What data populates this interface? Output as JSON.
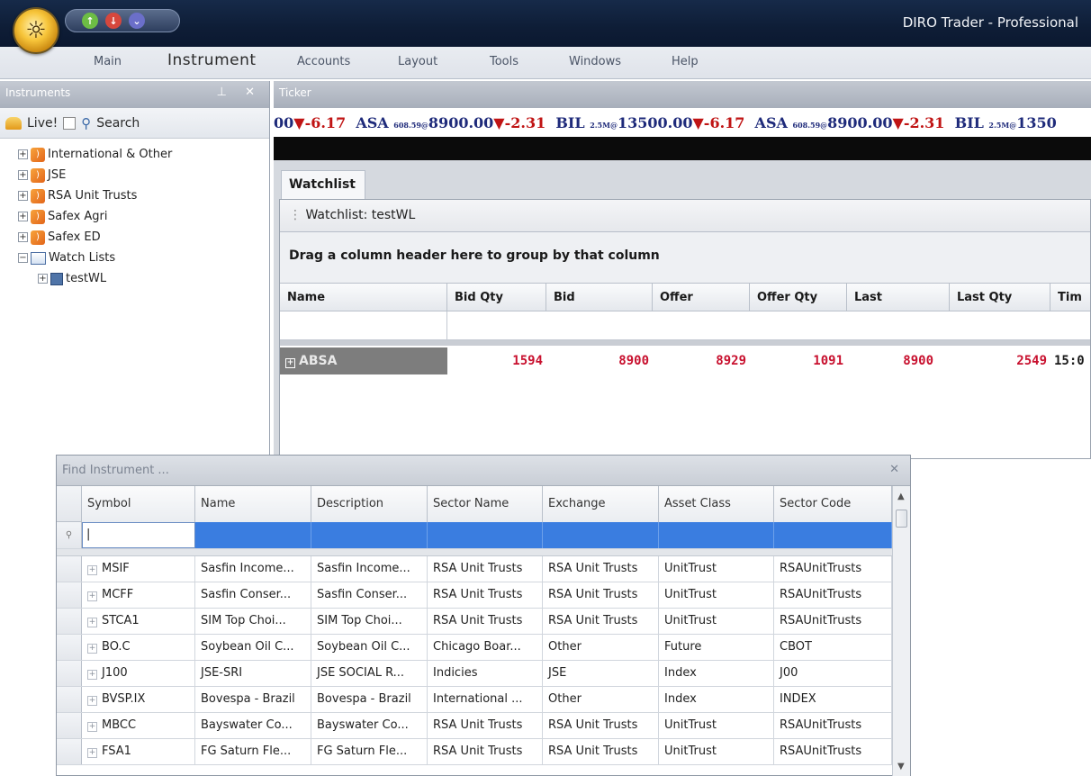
{
  "app": {
    "title": "DIRO Trader - Professional",
    "orb_icon": "logo-orb-icon"
  },
  "menu": [
    "Main",
    "Instrument",
    "Accounts",
    "Layout",
    "Tools",
    "Windows",
    "Help"
  ],
  "instruments_panel": {
    "title": "Instruments",
    "header_icons": "⊥ ✕",
    "toolbar": {
      "live_label": "Live!",
      "search_label": "Search"
    },
    "tree": [
      {
        "label": "International & Other",
        "icon": "rss-icon",
        "level": 0
      },
      {
        "label": "JSE",
        "icon": "rss-icon",
        "level": 0
      },
      {
        "label": "RSA Unit Trusts",
        "icon": "rss-icon",
        "level": 0
      },
      {
        "label": "Safex Agri",
        "icon": "rss-icon",
        "level": 0
      },
      {
        "label": "Safex ED",
        "icon": "rss-icon",
        "level": 0
      },
      {
        "label": "Watch Lists",
        "icon": "book-icon",
        "level": 0
      },
      {
        "label": "testWL",
        "icon": "watchlist-icon",
        "level": 1
      }
    ]
  },
  "ticker": {
    "title": "Ticker",
    "items": [
      {
        "text": "00",
        "change": "-6.17"
      },
      {
        "text": "ASA",
        "sub": "608.59@",
        "price": "8900.00",
        "change": "-2.31"
      },
      {
        "text": "BIL",
        "sub": "2.5M@",
        "price": "13500.00",
        "change": "-6.17"
      },
      {
        "text": "ASA",
        "sub": "608.59@",
        "price": "8900.00",
        "change": "-2.31"
      },
      {
        "text": "BIL",
        "sub": "2.5M@",
        "price": "1350"
      }
    ]
  },
  "watchlist": {
    "tab_label": "Watchlist",
    "subtitle": "Watchlist: testWL",
    "group_hint": "Drag a column header here to group by that column",
    "columns": [
      "Name",
      "Bid Qty",
      "Bid",
      "Offer",
      "Offer Qty",
      "Last",
      "Last Qty",
      "Tim"
    ],
    "rows": [
      {
        "name": "ABSA",
        "bid_qty": "1594",
        "bid": "8900",
        "offer": "8929",
        "offer_qty": "1091",
        "last": "8900",
        "last_qty": "2549",
        "time": "15:0"
      }
    ]
  },
  "find_instrument": {
    "title": "Find Instrument ...",
    "close": "✕",
    "columns": [
      "Symbol",
      "Name",
      "Description",
      "Sector Name",
      "Exchange",
      "Asset Class",
      "Sector Code"
    ],
    "filter_value": "|",
    "rows": [
      [
        "MSIF",
        "Sasfin Income...",
        "Sasfin Income...",
        "RSA Unit Trusts",
        "RSA Unit Trusts",
        "UnitTrust",
        "RSAUnitTrusts"
      ],
      [
        "MCFF",
        "Sasfin Conser...",
        "Sasfin Conser...",
        "RSA Unit Trusts",
        "RSA Unit Trusts",
        "UnitTrust",
        "RSAUnitTrusts"
      ],
      [
        "STCA1",
        "SIM Top Choi...",
        "SIM Top Choi...",
        "RSA Unit Trusts",
        "RSA Unit Trusts",
        "UnitTrust",
        "RSAUnitTrusts"
      ],
      [
        "BO.C",
        "Soybean Oil C...",
        "Soybean Oil C...",
        "Chicago Boar...",
        "Other",
        "Future",
        "CBOT"
      ],
      [
        "J100",
        "JSE-SRI",
        "JSE SOCIAL R...",
        "Indicies",
        "JSE",
        "Index",
        "J00"
      ],
      [
        "BVSP.IX",
        "Bovespa - Brazil",
        "Bovespa - Brazil",
        "International ...",
        "Other",
        "Index",
        "INDEX"
      ],
      [
        "MBCC",
        "Bayswater Co...",
        "Bayswater Co...",
        "RSA Unit Trusts",
        "RSA Unit Trusts",
        "UnitTrust",
        "RSAUnitTrusts"
      ],
      [
        "FSA1",
        "FG Saturn Fle...",
        "FG Saturn Fle...",
        "RSA Unit Trusts",
        "RSA Unit Trusts",
        "UnitTrust",
        "RSAUnitTrusts"
      ]
    ]
  },
  "colors": {
    "titlebar": "#0e1d36",
    "filter_row": "#3a7de0",
    "ticker_up": "#1e2a7a",
    "ticker_down": "#c01414",
    "watch_values": "#c8102e"
  }
}
